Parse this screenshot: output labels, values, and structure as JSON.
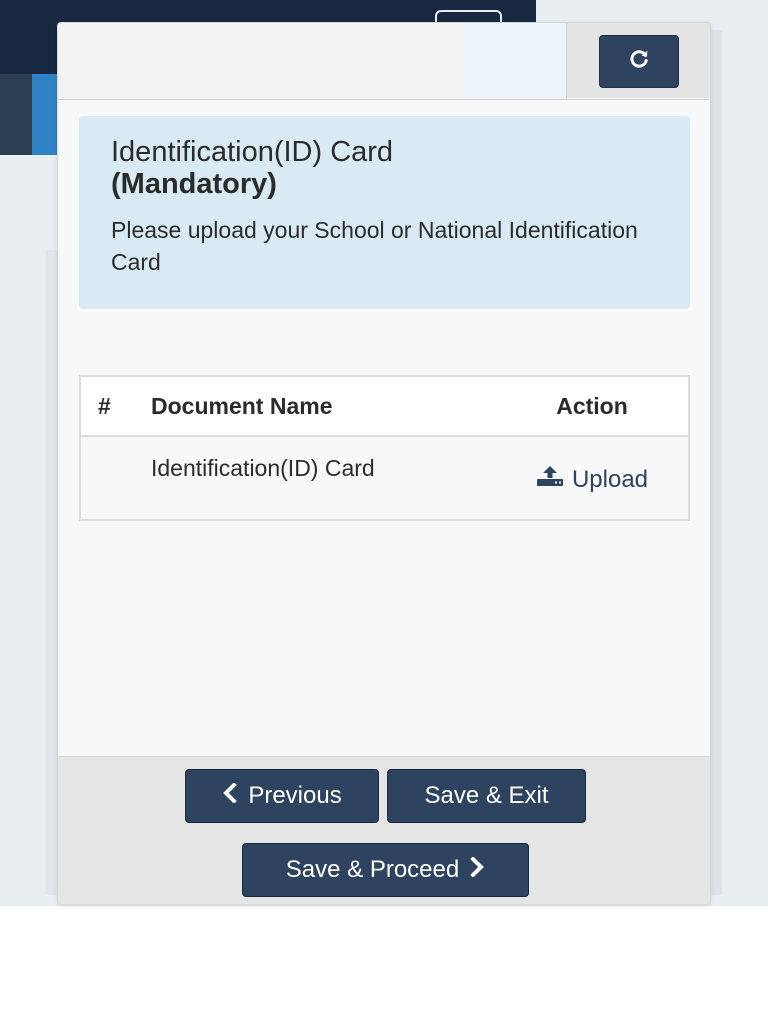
{
  "modal": {
    "refresh_icon": "refresh-icon"
  },
  "alert": {
    "title": "Identification(ID) Card",
    "title_strong": "(Mandatory)",
    "text": "Please upload your School or National Identification Card"
  },
  "table": {
    "headers": [
      "#",
      "Document Name",
      "Action"
    ],
    "rows": [
      {
        "num": "",
        "name": "Identification(ID) Card",
        "action_label": "Upload",
        "action_icon": "upload-icon"
      }
    ]
  },
  "footer": {
    "previous_label": "Previous",
    "previous_icon": "chevron-left-icon",
    "save_exit_label": "Save & Exit",
    "proceed_label": "Save & Proceed",
    "proceed_icon": "chevron-right-icon"
  },
  "colors": {
    "primary": "#2e4360",
    "alert_bg": "#d9eaf4",
    "navbar": "#172840",
    "accent_blue": "#2f82c4"
  }
}
